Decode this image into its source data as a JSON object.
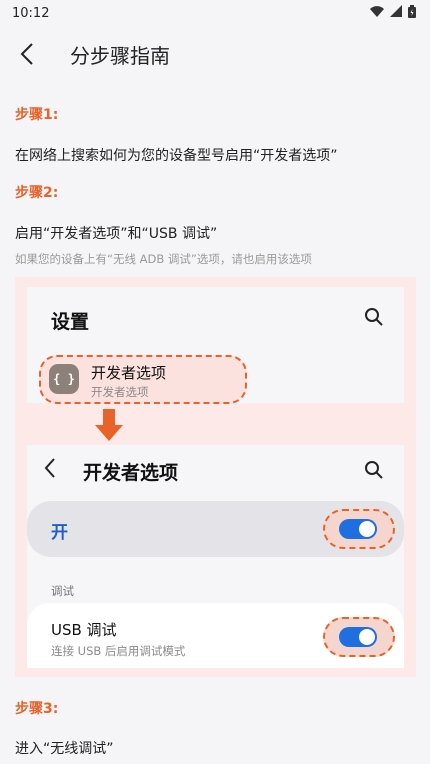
{
  "status_bar": {
    "time": "10:12"
  },
  "app_bar": {
    "title": "分步骤指南"
  },
  "steps": [
    {
      "label": "步骤1:",
      "text": "在网络上搜索如何为您的设备型号启用“开发者选项”"
    },
    {
      "label": "步骤2:",
      "text": "启用“开发者选项”和“USB 调试”",
      "hint": "如果您的设备上有“无线 ADB 调试”选项，请也启用该选项"
    },
    {
      "label": "步骤3:",
      "text": "进入“无线调试”"
    }
  ],
  "illustration": {
    "settings_title": "设置",
    "developer_item": {
      "name": "开发者选项",
      "subtitle": "开发者选项",
      "icon_glyph": "{ }"
    },
    "developer_page": {
      "title": "开发者选项",
      "on_label": "开",
      "section": "调试",
      "usb_item": {
        "name": "USB 调试",
        "subtitle": "连接 USB 后启用调试模式"
      }
    }
  },
  "colors": {
    "accent": "#e8622a",
    "toggle": "#1f6fe0",
    "illustration_bg": "#fdeae8"
  }
}
